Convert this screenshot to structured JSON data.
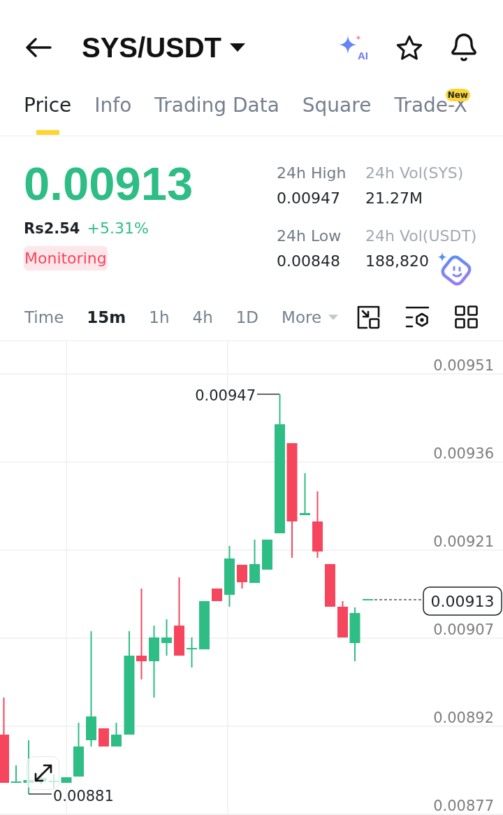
{
  "header": {
    "pair": "SYS/USDT",
    "ai_label": "AI"
  },
  "tabs": [
    {
      "label": "Price",
      "selected": true
    },
    {
      "label": "Info",
      "selected": false
    },
    {
      "label": "Trading Data",
      "selected": false
    },
    {
      "label": "Square",
      "selected": false
    },
    {
      "label": "Trade-X",
      "selected": false,
      "badge": "New"
    }
  ],
  "summary": {
    "last_price": "0.00913",
    "fiat_price": "Rs2.54",
    "change": "+5.31%",
    "tag": "Monitoring"
  },
  "stats": [
    {
      "label": "24h High",
      "value": "0.00947"
    },
    {
      "label": "24h Vol(SYS)",
      "value": "21.27M"
    },
    {
      "label": "24h Low",
      "value": "0.00848"
    },
    {
      "label": "24h Vol(USDT)",
      "value": "188,820"
    }
  ],
  "intervals": [
    {
      "label": "Time",
      "kind": "option",
      "selected": false
    },
    {
      "label": "15m",
      "kind": "option",
      "selected": true
    },
    {
      "label": "1h",
      "kind": "option",
      "selected": false
    },
    {
      "label": "4h",
      "kind": "option",
      "selected": false
    },
    {
      "label": "1D",
      "kind": "option",
      "selected": false
    },
    {
      "label": "More",
      "kind": "dropdown",
      "selected": false
    }
  ],
  "chart": {
    "price_axis": [
      "0.00951",
      "0.00936",
      "0.00921",
      "0.00907",
      "0.00892",
      "0.00877"
    ],
    "high_label": "0.00947",
    "low_label": "0.00881",
    "last_price": "0.00913"
  }
}
